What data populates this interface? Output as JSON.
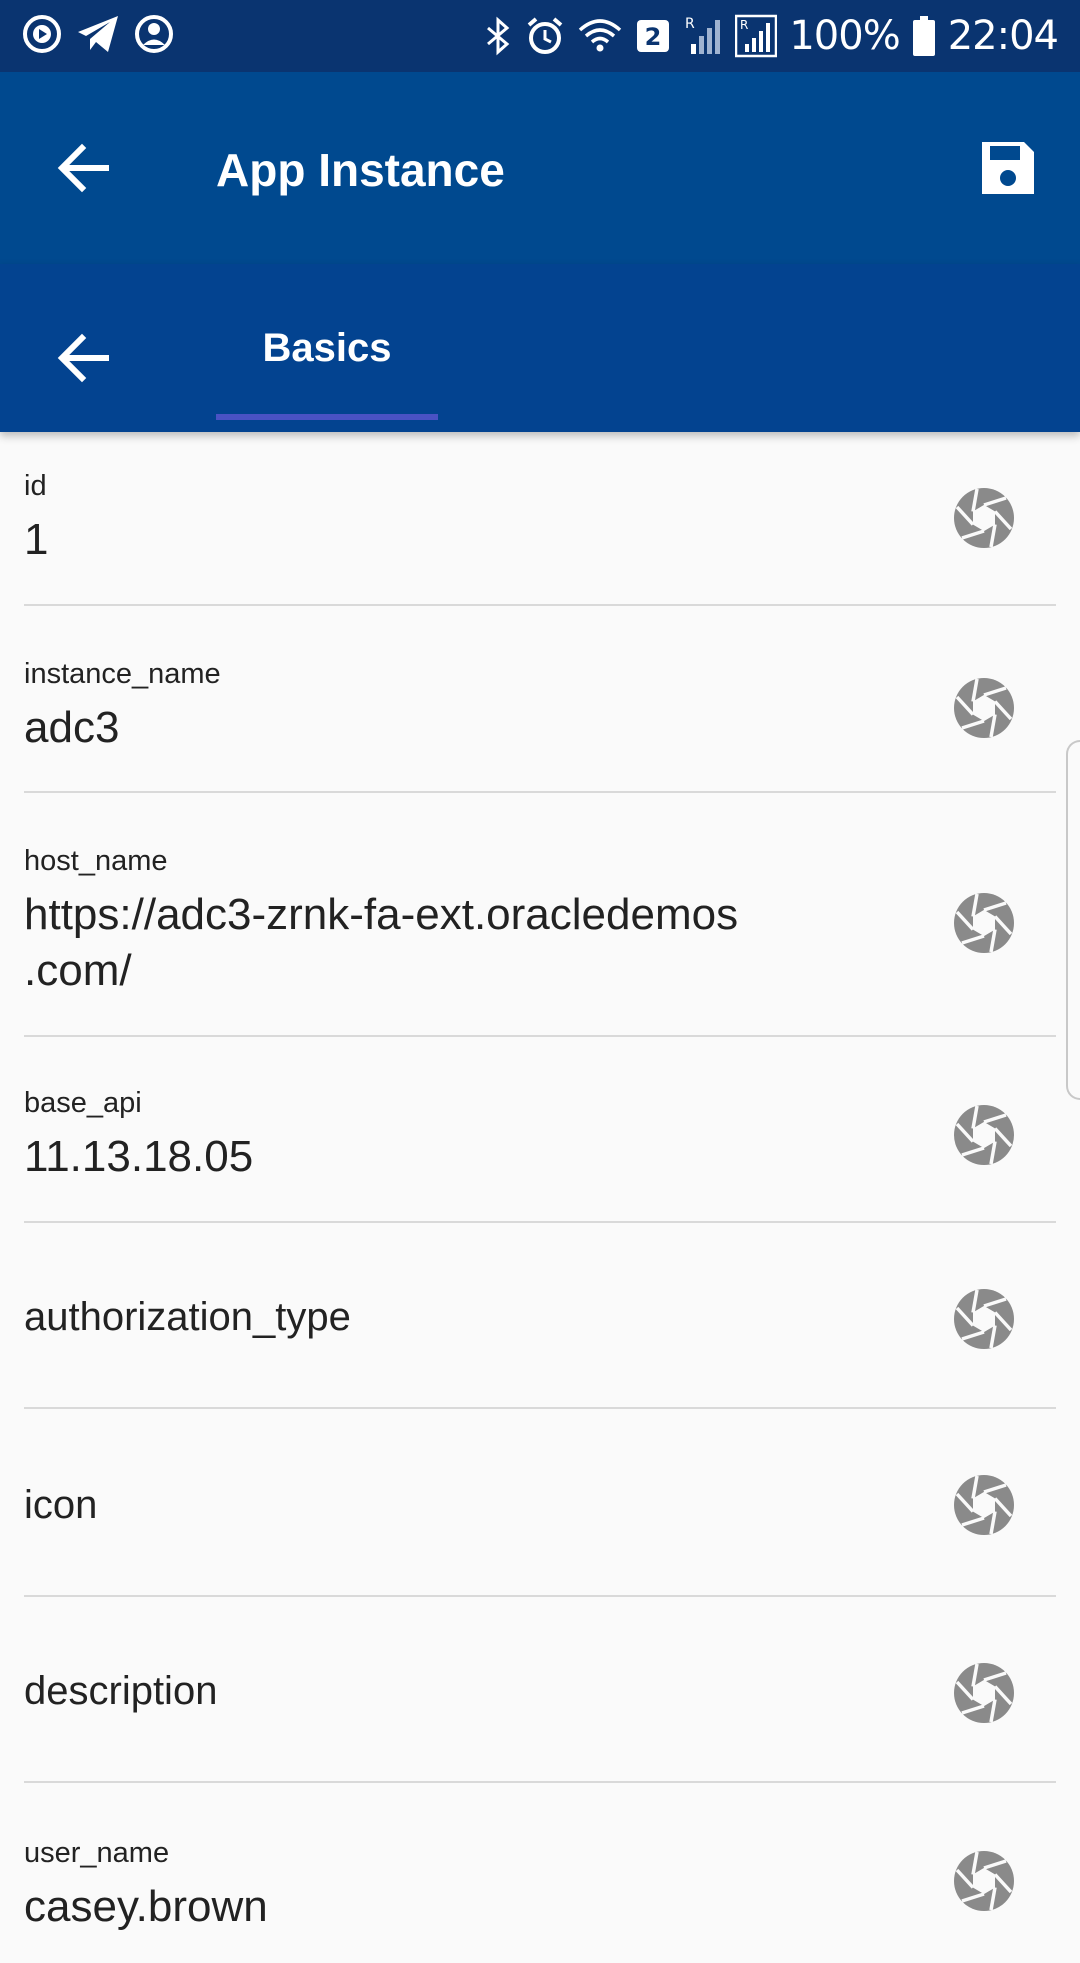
{
  "status_bar": {
    "battery": "100%",
    "time": "22:04",
    "sim_badge": "2",
    "icons": [
      "play-circle-icon",
      "telegram-icon",
      "account-circle-icon",
      "bluetooth-icon",
      "alarm-icon",
      "wifi-icon",
      "sim-2-badge-icon",
      "signal-r-icon",
      "signal-r-boxed-icon",
      "battery-icon"
    ]
  },
  "app_bar": {
    "title": "App Instance",
    "back_icon": "arrow-back-icon",
    "save_icon": "save-icon"
  },
  "tabs": [
    {
      "label": "Basics",
      "selected": true
    }
  ],
  "fields": [
    {
      "label": "id",
      "value": "1"
    },
    {
      "label": "instance_name",
      "value": "adc3"
    },
    {
      "label": "host_name",
      "value_line1": "https://adc3-zrnk-fa-ext.oracledemos",
      "value_line2": ".com/"
    },
    {
      "label": "base_api",
      "value": "11.13.18.05"
    },
    {
      "placeholder": "authorization_type"
    },
    {
      "placeholder": "icon"
    },
    {
      "placeholder": "description"
    },
    {
      "label": "user_name",
      "value": "casey.brown"
    }
  ],
  "colors": {
    "status_bar": "#0a3470",
    "app_bar": "#00498f",
    "tab_bar": "#034390",
    "tab_indicator": "#4a52c4",
    "camera_icon": "#8a8a8a"
  }
}
